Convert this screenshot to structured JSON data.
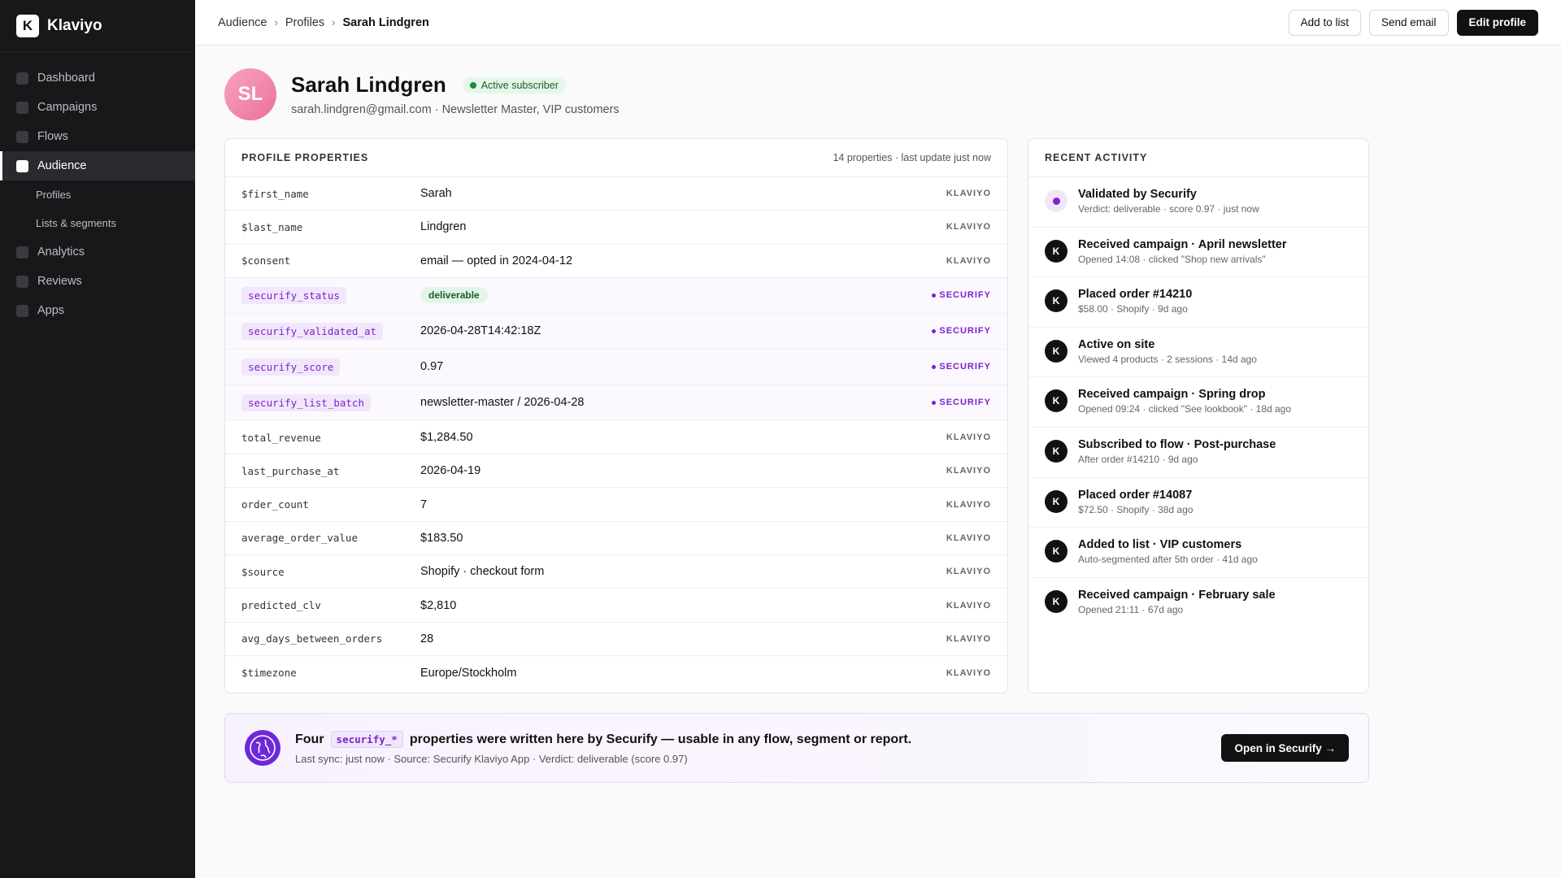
{
  "app": {
    "name": "Klaviyo",
    "logo_letter": "K"
  },
  "sidebar": {
    "items": [
      {
        "label": "Dashboard"
      },
      {
        "label": "Campaigns"
      },
      {
        "label": "Flows"
      },
      {
        "label": "Audience"
      },
      {
        "label": "Analytics"
      },
      {
        "label": "Reviews"
      },
      {
        "label": "Apps"
      }
    ],
    "subitems": [
      {
        "label": "Profiles"
      },
      {
        "label": "Lists & segments"
      }
    ]
  },
  "breadcrumb": {
    "items": [
      "Audience",
      "Profiles",
      "Sarah Lindgren"
    ],
    "separator": "›"
  },
  "actions": {
    "add_to_list": "Add to list",
    "send_email": "Send email",
    "edit_profile": "Edit profile"
  },
  "profile": {
    "initials": "SL",
    "name": "Sarah Lindgren",
    "status": "Active subscriber",
    "subline": "sarah.lindgren@gmail.com · Newsletter Master, VIP customers"
  },
  "properties": {
    "title": "PROFILE PROPERTIES",
    "meta": "14 properties · last update just now",
    "rows": [
      {
        "key": "$first_name",
        "value": "Sarah",
        "source": "KLAVIYO"
      },
      {
        "key": "$last_name",
        "value": "Lindgren",
        "source": "KLAVIYO"
      },
      {
        "key": "$consent",
        "value": "email — opted in 2024-04-12",
        "source": "KLAVIYO"
      },
      {
        "key": "securify_status",
        "value": "deliverable",
        "source": "SECURIFY"
      },
      {
        "key": "securify_validated_at",
        "value": "2026-04-28T14:42:18Z",
        "source": "SECURIFY"
      },
      {
        "key": "securify_score",
        "value": "0.97",
        "source": "SECURIFY"
      },
      {
        "key": "securify_list_batch",
        "value": "newsletter-master / 2026-04-28",
        "source": "SECURIFY"
      },
      {
        "key": "total_revenue",
        "value": "$1,284.50",
        "source": "KLAVIYO"
      },
      {
        "key": "last_purchase_at",
        "value": "2026-04-19",
        "source": "KLAVIYO"
      },
      {
        "key": "order_count",
        "value": "7",
        "source": "KLAVIYO"
      },
      {
        "key": "average_order_value",
        "value": "$183.50",
        "source": "KLAVIYO"
      },
      {
        "key": "$source",
        "value": "Shopify · checkout form",
        "source": "KLAVIYO"
      },
      {
        "key": "predicted_clv",
        "value": "$2,810",
        "source": "KLAVIYO"
      },
      {
        "key": "avg_days_between_orders",
        "value": "28",
        "source": "KLAVIYO"
      },
      {
        "key": "$timezone",
        "value": "Europe/Stockholm",
        "source": "KLAVIYO"
      }
    ]
  },
  "activity": {
    "title": "RECENT ACTIVITY",
    "items": [
      {
        "icon": "securify-dot-icon",
        "letter": "",
        "title": "Validated by Securify",
        "sub": "Verdict: deliverable · score 0.97 · just now"
      },
      {
        "icon": "klaviyo-icon",
        "letter": "K",
        "title": "Received campaign · April newsletter",
        "sub": "Opened 14:08 · clicked \"Shop new arrivals\""
      },
      {
        "icon": "klaviyo-icon",
        "letter": "K",
        "title": "Placed order #14210",
        "sub": "$58.00 · Shopify · 9d ago"
      },
      {
        "icon": "klaviyo-icon",
        "letter": "K",
        "title": "Active on site",
        "sub": "Viewed 4 products · 2 sessions · 14d ago"
      },
      {
        "icon": "klaviyo-icon",
        "letter": "K",
        "title": "Received campaign · Spring drop",
        "sub": "Opened 09:24 · clicked \"See lookbook\" · 18d ago"
      },
      {
        "icon": "klaviyo-icon",
        "letter": "K",
        "title": "Subscribed to flow · Post-purchase",
        "sub": "After order #14210 · 9d ago"
      },
      {
        "icon": "klaviyo-icon",
        "letter": "K",
        "title": "Placed order #14087",
        "sub": "$72.50 · Shopify · 38d ago"
      },
      {
        "icon": "klaviyo-icon",
        "letter": "K",
        "title": "Added to list · VIP customers",
        "sub": "Auto-segmented after 5th order · 41d ago"
      },
      {
        "icon": "klaviyo-icon",
        "letter": "K",
        "title": "Received campaign · February sale",
        "sub": "Opened 21:11 · 67d ago"
      }
    ]
  },
  "banner": {
    "title_before": "Four",
    "code": "securify_*",
    "title_after": "properties were written here by Securify — usable in any flow, segment or report.",
    "sub": "Last sync: just now · Source: Securify Klaviyo App · Verdict: deliverable (score 0.97)",
    "button": "Open in Securify →"
  },
  "colors": {
    "accent_purple": "#7e22ce",
    "sidebar_bg": "#18181b",
    "success_green": "#1d8a40"
  }
}
